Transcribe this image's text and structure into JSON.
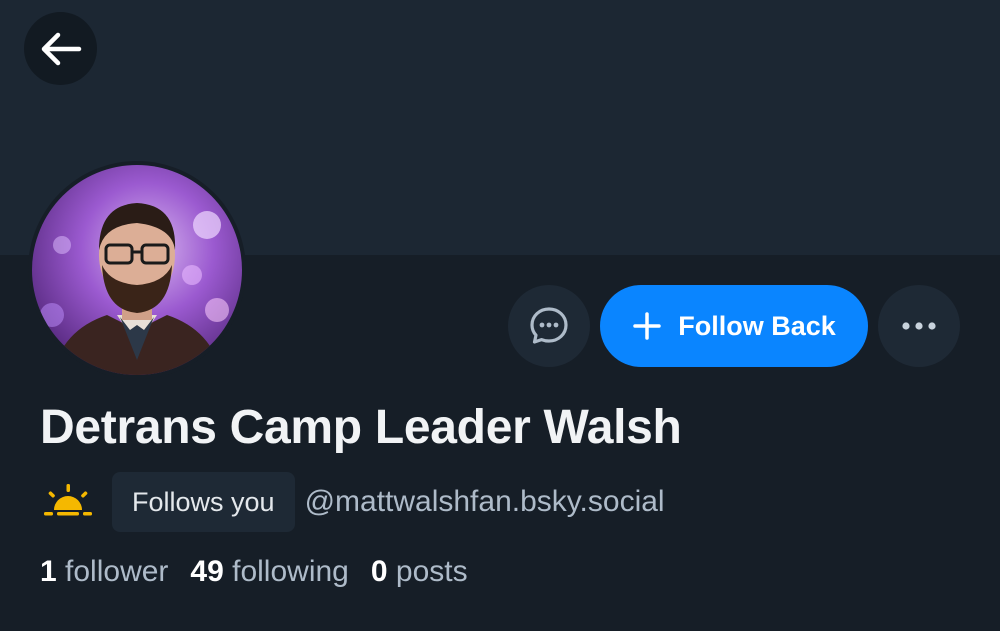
{
  "profile": {
    "display_name": "Detrans Camp Leader Walsh",
    "follows_you_badge": "Follows you",
    "handle": "@mattwalshfan.bsky.social",
    "follow_back_label": "Follow Back"
  },
  "stats": {
    "followers_count": "1",
    "followers_label": "follower",
    "following_count": "49",
    "following_label": "following",
    "posts_count": "0",
    "posts_label": "posts"
  },
  "icons": {
    "back": "arrow-left-icon",
    "message": "chat-bubble-icon",
    "follow": "plus-icon",
    "more": "ellipsis-icon",
    "emoji": "sunrise-icon"
  },
  "colors": {
    "background": "#161e27",
    "banner": "#1c2733",
    "accent": "#0a85ff",
    "secondary_text": "#aebbc9",
    "sun": "#f5b800"
  }
}
